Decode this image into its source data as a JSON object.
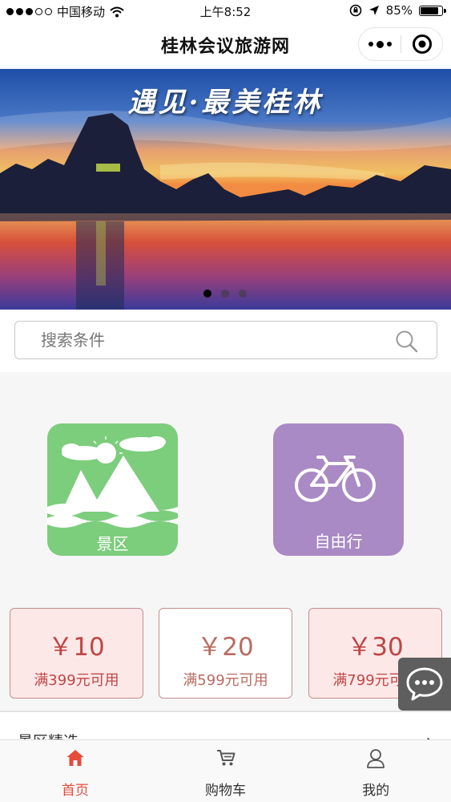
{
  "status_bar": {
    "carrier": "中国移动",
    "time": "上午8:52",
    "battery_text": "85%",
    "battery_level": 0.85
  },
  "nav": {
    "title": "桂林会议旅游网"
  },
  "banner": {
    "caption": "遇见·最美桂林",
    "slide_count": 3,
    "active_slide": 1
  },
  "search": {
    "placeholder": "搜索条件"
  },
  "categories": [
    {
      "label": "景区",
      "icon": "mountain-sun-icon",
      "color": "#7ccd7c"
    },
    {
      "label": "自由行",
      "icon": "bicycle-icon",
      "color": "#a98ac4"
    }
  ],
  "coupons": [
    {
      "amount": "￥10",
      "condition": "满399元可用"
    },
    {
      "amount": "￥20",
      "condition": "满599元可用"
    },
    {
      "amount": "￥30",
      "condition": "满799元可用"
    }
  ],
  "section": {
    "title": "景区精选",
    "arrow": "›"
  },
  "tabs": [
    {
      "label": "首页",
      "icon": "home-icon",
      "active": true
    },
    {
      "label": "购物车",
      "icon": "cart-icon",
      "active": false
    },
    {
      "label": "我的",
      "icon": "user-icon",
      "active": false
    }
  ],
  "colors": {
    "accent": "#e64b3c",
    "coupon_text": "#c04545"
  }
}
